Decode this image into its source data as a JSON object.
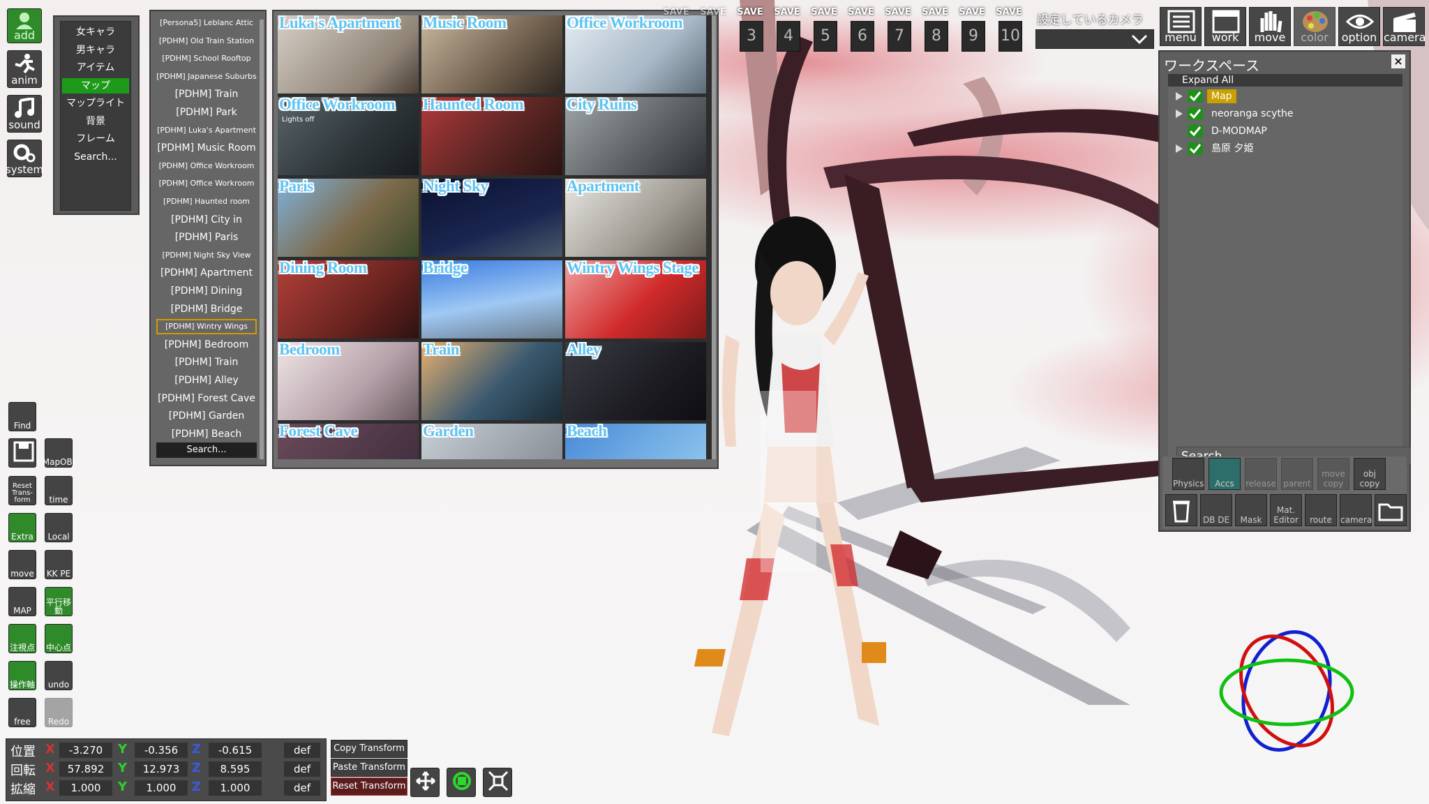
{
  "colors": {
    "accent_green": "#1e9a1a",
    "title_blue": "#5fc4f2",
    "highlight_orange": "#d29a00",
    "workspace_map_tag": "#c9a000"
  },
  "left_toolbar": {
    "add": "add",
    "anim": "anim",
    "sound": "sound",
    "system": "system",
    "find": "Find",
    "mapobj": "MapOBJ",
    "reset": "Reset Trans-form",
    "time": "time",
    "extra": "Extra",
    "local": "Local",
    "move": "move",
    "kkpe": "KK PE",
    "map": "MAP",
    "parallel": "平行移動",
    "target": "注視点",
    "center": "中心点",
    "axis": "操作軸",
    "undo": "undo",
    "free": "free",
    "redo": "Redo"
  },
  "category_menu": {
    "items": [
      "女キャラ",
      "男キャラ",
      "アイテム",
      "マップ",
      "マップライト",
      "背景",
      "フレーム",
      "Search..."
    ],
    "selected_index": 3
  },
  "map_list": {
    "items": [
      "[Persona5] Leblanc Attic",
      "[PDHM] Old Train Station",
      "[PDHM] School Rooftop",
      "[PDHM] Japanese Suburbs",
      "[PDHM] Train Station",
      "[PDHM] Park",
      "[PDHM] Luka's Apartment",
      "[PDHM] Music Room",
      "[PDHM] Office Workroom A",
      "[PDHM] Office Workroom B",
      "[PDHM] Haunted room",
      "[PDHM] City in Ruins",
      "[PDHM] Paris",
      "[PDHM] Night Sky View",
      "[PDHM] Apartment",
      "[PDHM] Dining Room",
      "[PDHM] Bridge",
      "[PDHM] Wintry Wings Stage",
      "[PDHM] Bedroom",
      "[PDHM] Train",
      "[PDHM] Alley",
      "[PDHM] Forest Cave",
      "[PDHM] Garden",
      "[PDHM] Beach"
    ],
    "highlighted_index": 17,
    "search": "Search..."
  },
  "thumbnails": [
    {
      "title": "Luka's Apartment",
      "sub": ""
    },
    {
      "title": "Music Room",
      "sub": ""
    },
    {
      "title": "Office Workroom",
      "sub": ""
    },
    {
      "title": "Office Workroom",
      "sub": "Lights off"
    },
    {
      "title": "Haunted Room",
      "sub": ""
    },
    {
      "title": "City Ruins",
      "sub": ""
    },
    {
      "title": "Paris",
      "sub": ""
    },
    {
      "title": "Night Sky",
      "sub": ""
    },
    {
      "title": "Apartment",
      "sub": ""
    },
    {
      "title": "Dining Room",
      "sub": ""
    },
    {
      "title": "Bridge",
      "sub": ""
    },
    {
      "title": "Wintry Wings Stage",
      "sub": ""
    },
    {
      "title": "Bedroom",
      "sub": ""
    },
    {
      "title": "Train",
      "sub": ""
    },
    {
      "title": "Alley",
      "sub": ""
    },
    {
      "title": "Forest Cave",
      "sub": ""
    },
    {
      "title": "Garden",
      "sub": ""
    },
    {
      "title": "Beach",
      "sub": ""
    }
  ],
  "save_slots": [
    {
      "label": "SAVE",
      "num": ""
    },
    {
      "label": "SAVE",
      "num": ""
    },
    {
      "label": "SAVE",
      "num": "3"
    },
    {
      "label": "SAVE",
      "num": "4"
    },
    {
      "label": "SAVE",
      "num": "5"
    },
    {
      "label": "SAVE",
      "num": "6"
    },
    {
      "label": "SAVE",
      "num": "7"
    },
    {
      "label": "SAVE",
      "num": "8"
    },
    {
      "label": "SAVE",
      "num": "9"
    },
    {
      "label": "SAVE",
      "num": "10"
    }
  ],
  "camera": {
    "label": "設定しているカメラ",
    "value": ""
  },
  "top_buttons": [
    "menu",
    "work",
    "move",
    "color",
    "option",
    "camera"
  ],
  "workspace": {
    "title": "ワークスペース",
    "close": "×",
    "expand_all": "Expand All",
    "items": [
      {
        "label": "Map",
        "tagged": true,
        "expandable": true
      },
      {
        "label": "neoranga scythe",
        "tagged": false,
        "expandable": true
      },
      {
        "label": "D-MODMAP",
        "tagged": false,
        "expandable": false
      },
      {
        "label": "島原 夕姫",
        "tagged": false,
        "expandable": true
      }
    ],
    "search_placeholder": "Search...",
    "buttons_row1": [
      "Physics",
      "Accs",
      "release",
      "parent",
      "move copy",
      "obj copy"
    ],
    "buttons_row2": [
      "",
      "DB DE",
      "Mask",
      "Mat. Editor",
      "route",
      "camera",
      ""
    ]
  },
  "transform": {
    "rows": [
      {
        "label": "位置",
        "x": "-3.270",
        "y": "-0.356",
        "z": "-0.615",
        "def": "def"
      },
      {
        "label": "回転",
        "x": "57.892",
        "y": "12.973",
        "z": "8.595",
        "def": "def"
      },
      {
        "label": "拡縮",
        "x": "1.000",
        "y": "1.000",
        "z": "1.000",
        "def": "def"
      }
    ],
    "axes": {
      "x": "X",
      "y": "Y",
      "z": "Z"
    },
    "copy": "Copy Transform",
    "paste": "Paste Transform",
    "reset": "Reset Transform"
  }
}
